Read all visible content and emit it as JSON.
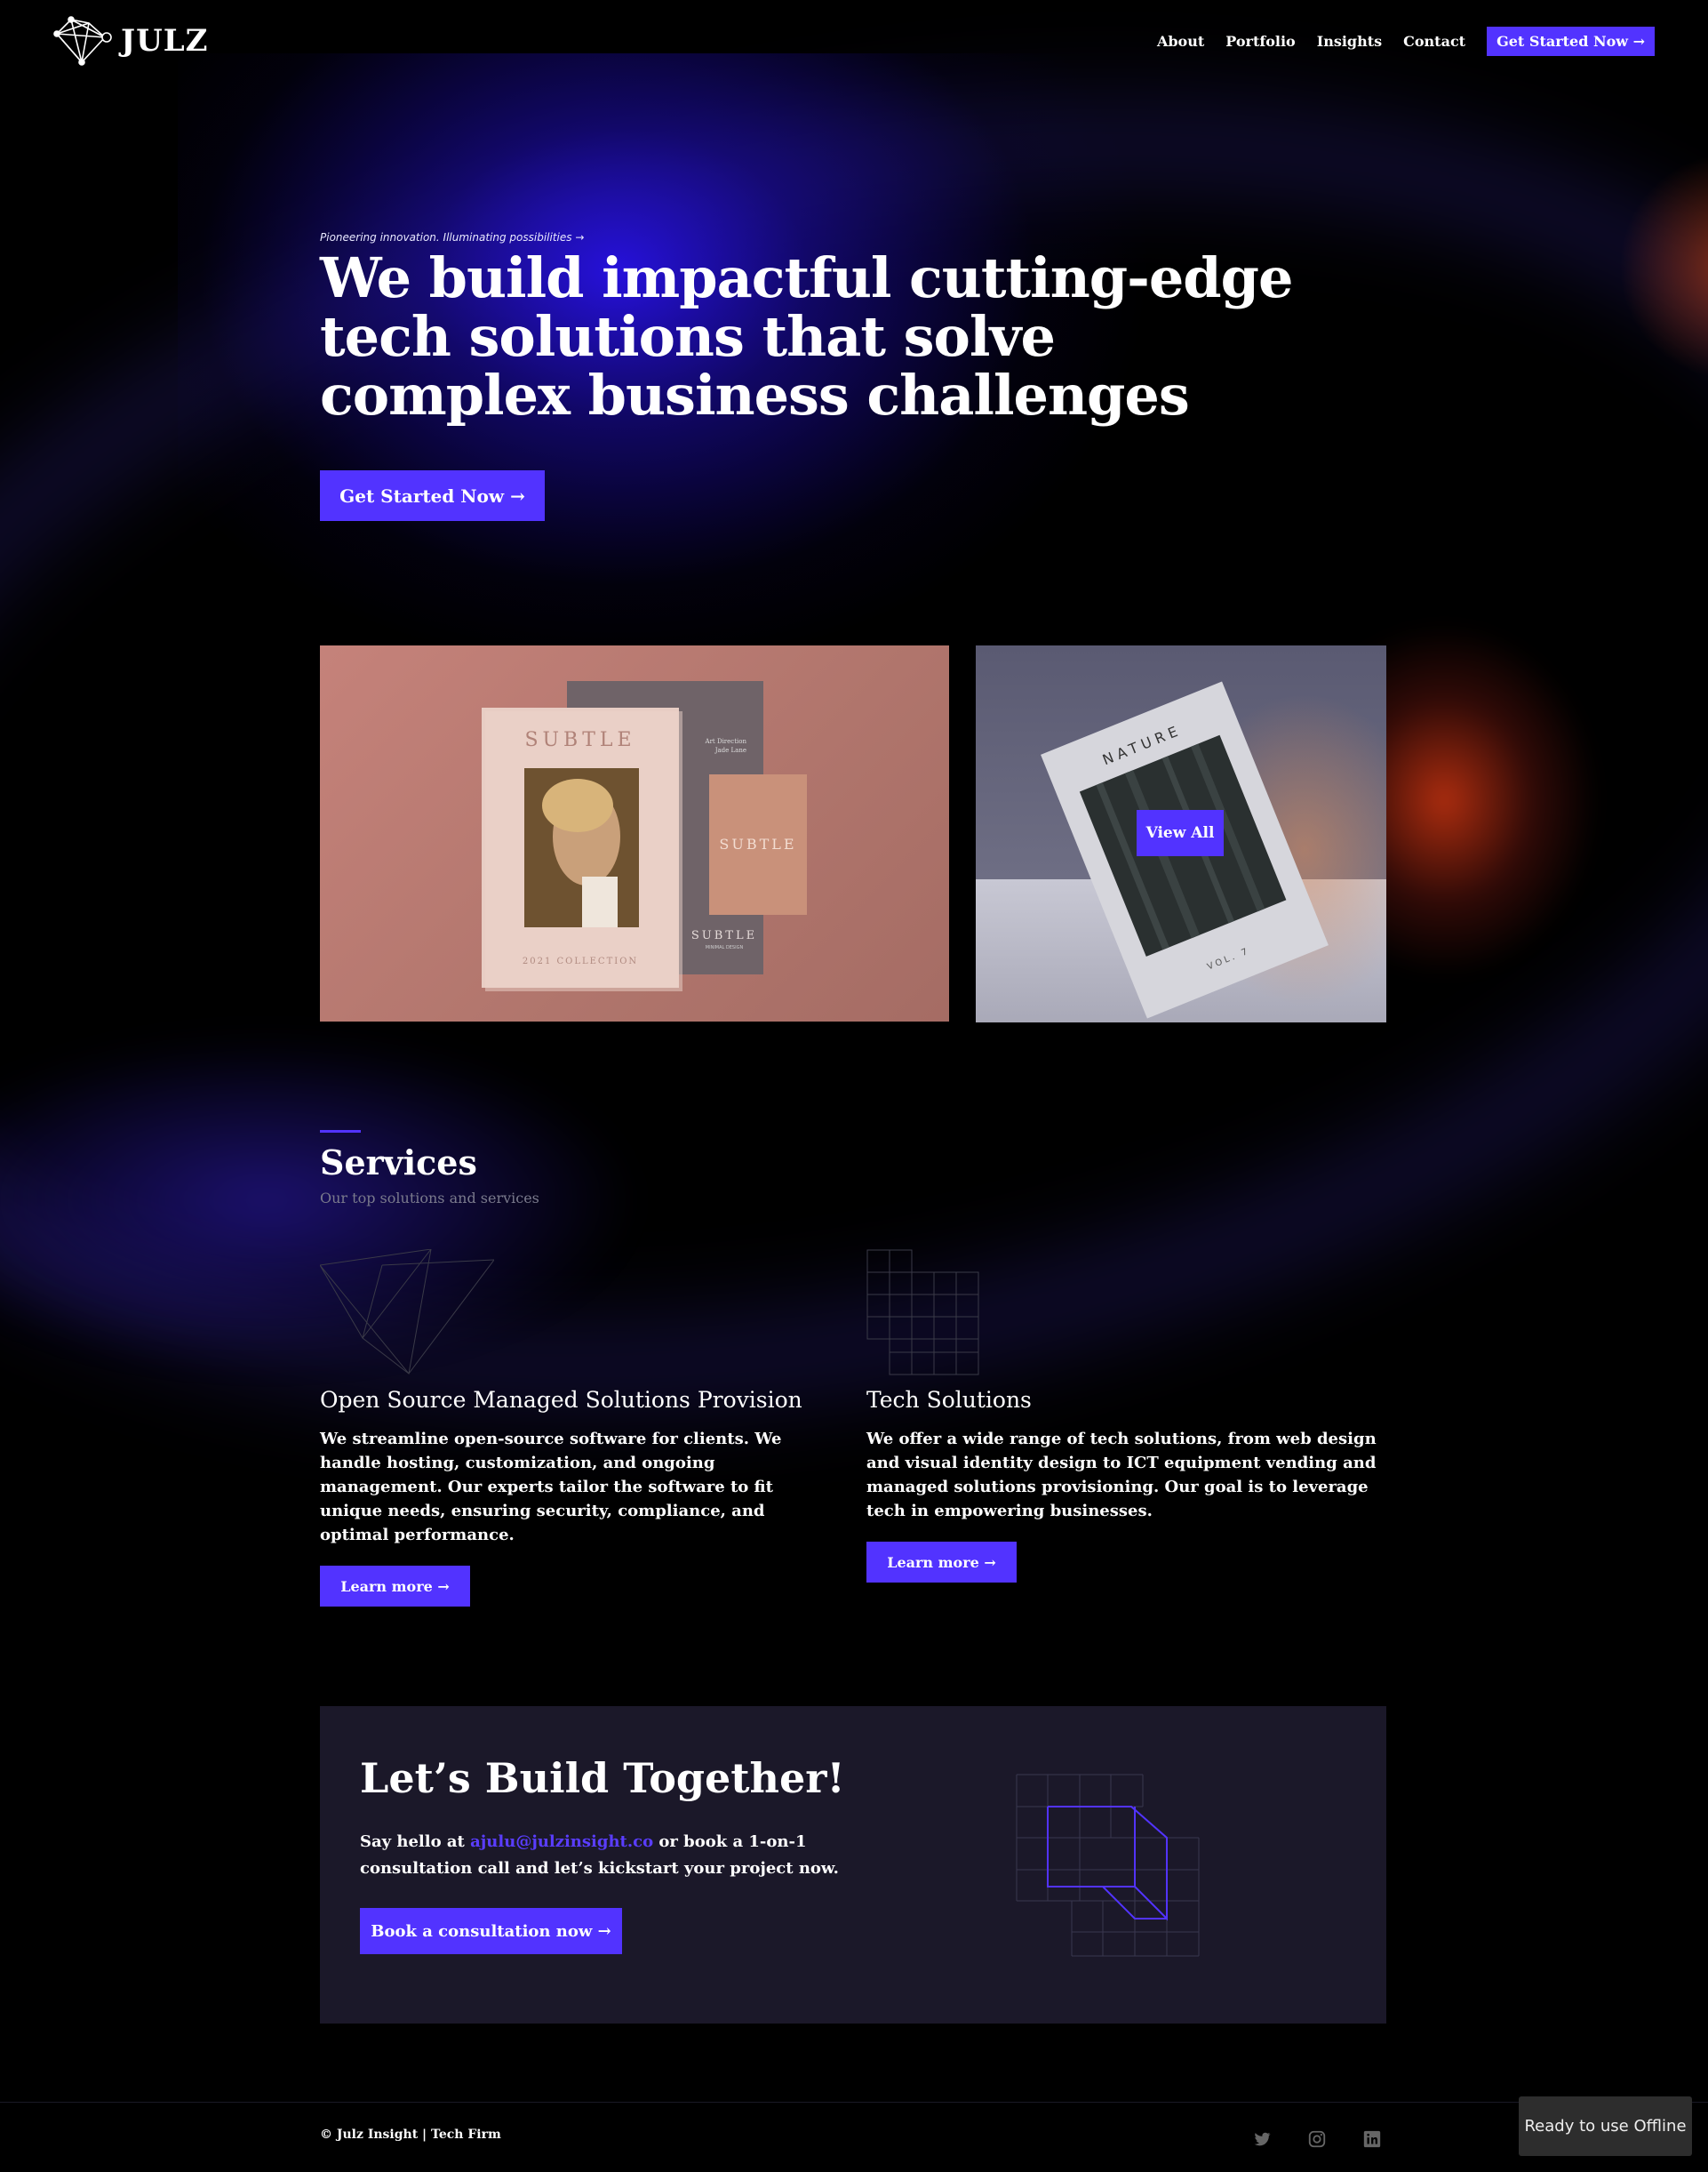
{
  "brand": {
    "name": "JULZ"
  },
  "nav": {
    "items": [
      "About",
      "Portfolio",
      "Insights",
      "Contact"
    ],
    "cta": "Get Started Now →"
  },
  "hero": {
    "tagline": "Pioneering innovation. Illuminating possibilities →",
    "title": "We build impactful cutting-edge tech solutions that solve complex business challenges",
    "button": "Get Started Now →"
  },
  "gallery": {
    "left_card": {
      "cover_title": "SUBTLE",
      "cover_footer": "2021 COLLECTION",
      "small_card_title": "SUBTLE",
      "back_card_title": "SUBTLE",
      "back_card_sub": "MINIMAL DESIGN",
      "back_card_top": "Art Direction",
      "back_card_name": "Jade Lane"
    },
    "right_card": {
      "book_title": "NATURE",
      "book_volume": "VOL. 7",
      "button": "View All"
    }
  },
  "services": {
    "title": "Services",
    "subtitle": "Our top solutions and services",
    "items": [
      {
        "title": "Open Source Managed Solutions Provision",
        "description": "We streamline open-source software for clients. We handle hosting, customization, and ongoing management. Our experts tailor the software to fit unique needs, ensuring security, compliance, and optimal performance.",
        "button": "Learn more →"
      },
      {
        "title": "Tech Solutions",
        "description": "We offer a wide range of tech solutions, from web design and visual identity design to ICT equipment vending and managed solutions provisioning. Our goal is to leverage tech in empowering businesses.",
        "button": "Learn more →"
      }
    ]
  },
  "cta_section": {
    "title": "Let’s Build Together!",
    "text_before": "Say hello at ",
    "email": "ajulu@julzinsight.co",
    "text_after": " or book a 1-on-1 consultation call and let’s kickstart your project now.",
    "button": "Book a consultation now →"
  },
  "footer": {
    "copyright": "© Julz Insight | Tech Firm",
    "social": [
      "twitter-icon",
      "instagram-icon",
      "linkedin-icon"
    ]
  },
  "offline_badge": "Ready to use Offline",
  "colors": {
    "accent": "#5233ff",
    "background": "#000000",
    "panel": "#1b1829"
  }
}
